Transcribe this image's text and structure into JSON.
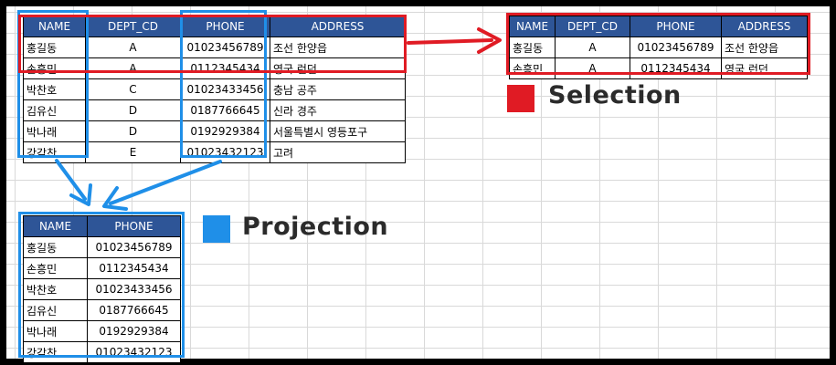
{
  "source_table": {
    "headers": [
      "NAME",
      "DEPT_CD",
      "PHONE",
      "ADDRESS"
    ],
    "rows": [
      [
        "홍길동",
        "A",
        "01023456789",
        "조선 한양읍"
      ],
      [
        "손흥민",
        "A",
        "0112345434",
        "영국 런던"
      ],
      [
        "박찬호",
        "C",
        "01023433456",
        "충남 공주"
      ],
      [
        "김유신",
        "D",
        "0187766645",
        "신라 경주"
      ],
      [
        "박나래",
        "D",
        "0192929384",
        "서울특별시 영등포구"
      ],
      [
        "강감찬",
        "E",
        "01023432123",
        "고려"
      ]
    ]
  },
  "selection_table": {
    "headers": [
      "NAME",
      "DEPT_CD",
      "PHONE",
      "ADDRESS"
    ],
    "rows": [
      [
        "홍길동",
        "A",
        "01023456789",
        "조선 한양읍"
      ],
      [
        "손흥민",
        "A",
        "0112345434",
        "영국 런던"
      ]
    ]
  },
  "projection_table": {
    "headers": [
      "NAME",
      "PHONE"
    ],
    "rows": [
      [
        "홍길동",
        "01023456789"
      ],
      [
        "손흥민",
        "0112345434"
      ],
      [
        "박찬호",
        "01023433456"
      ],
      [
        "김유신",
        "0187766645"
      ],
      [
        "박나래",
        "0192929384"
      ],
      [
        "강감찬",
        "01023432123"
      ]
    ]
  },
  "legend": {
    "selection": {
      "label": "Selection",
      "color": "#e01b24"
    },
    "projection": {
      "label": "Projection",
      "color": "#1f8fe8"
    }
  },
  "colors": {
    "header_bg": "#2e5597",
    "selection_highlight": "#e01b24",
    "projection_highlight": "#1f8fe8"
  }
}
